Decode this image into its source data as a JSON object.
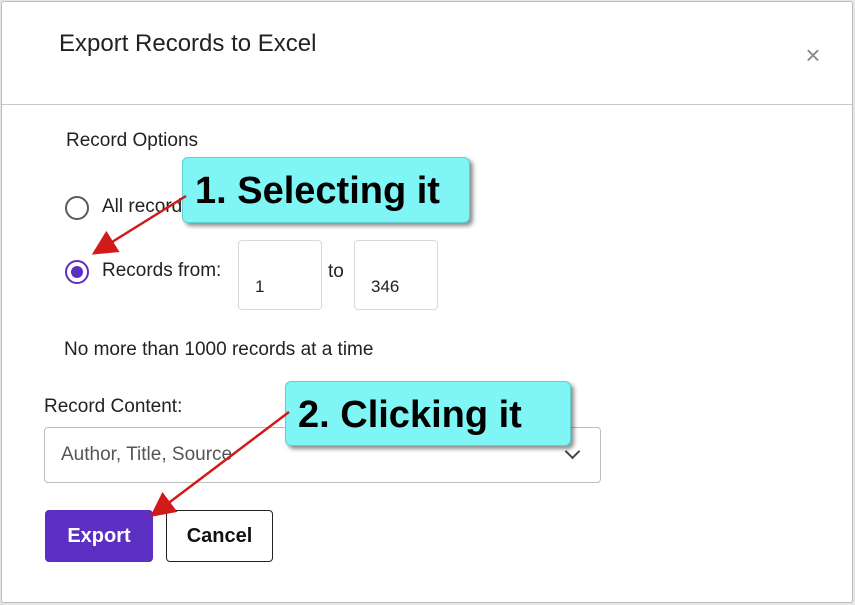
{
  "dialog": {
    "title": "Export Records to Excel",
    "close_glyph": "×"
  },
  "record_options": {
    "label": "Record Options",
    "all_records_label": "All records",
    "records_from_label": "Records from:",
    "from_value": "1",
    "to_label": "to",
    "to_value": "346",
    "selected": "records_from"
  },
  "note": "No more than 1000 records at a time",
  "record_content": {
    "label": "Record Content:",
    "selected_value": "Author, Title, Source"
  },
  "buttons": {
    "export_label": "Export",
    "cancel_label": "Cancel"
  },
  "annotations": {
    "callout_1": "1. Selecting it",
    "callout_2": "2. Clicking it"
  },
  "colors": {
    "accent": "#5b2fc2",
    "callout_bg": "#7ff5f5",
    "arrow": "#d11a1a"
  }
}
